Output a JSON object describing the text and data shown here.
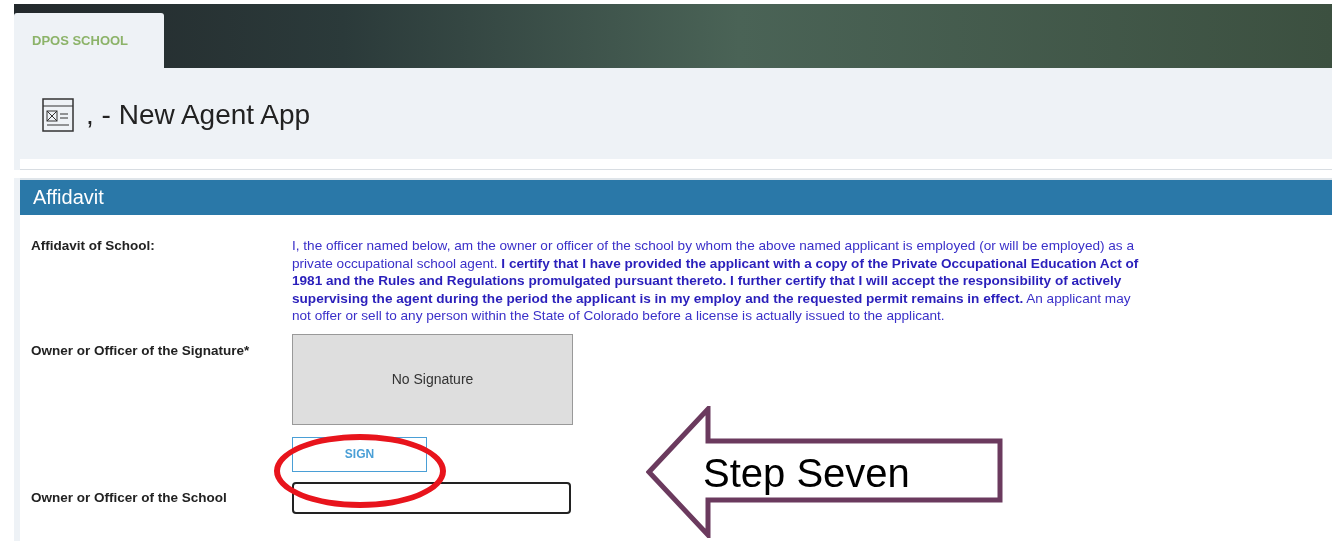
{
  "header": {
    "tab": "DPOS SCHOOL"
  },
  "page": {
    "title": ", - New Agent App"
  },
  "section": {
    "title": "Affidavit",
    "fields": [
      {
        "kind": "text",
        "label": "Affidavit of School:",
        "text": "I, the officer named below, am the owner or officer of the school by whom the above named applicant is employed (or will be employed) as a private occupational school agent.  **I certify that I have provided the applicant with a copy of the Private Occupational Education Act of 1981 and the Rules and Regulations promulgated pursuant thereto.  I further certify that I will accept the responsibility of actively supervising the agent during the period the applicant is in my employ and the requested permit remains in effect.**  An applicant may not offer or sell to any person within the State of Colorado before a license is actually issued to the applicant."
      },
      {
        "kind": "signature",
        "label": "Owner or Officer of the Signature*",
        "text": "No Signature",
        "button": "SIGN"
      },
      {
        "kind": "input",
        "label": "Owner or Officer of the School"
      }
    ]
  },
  "annotation": {
    "text": "Step Seven"
  }
}
